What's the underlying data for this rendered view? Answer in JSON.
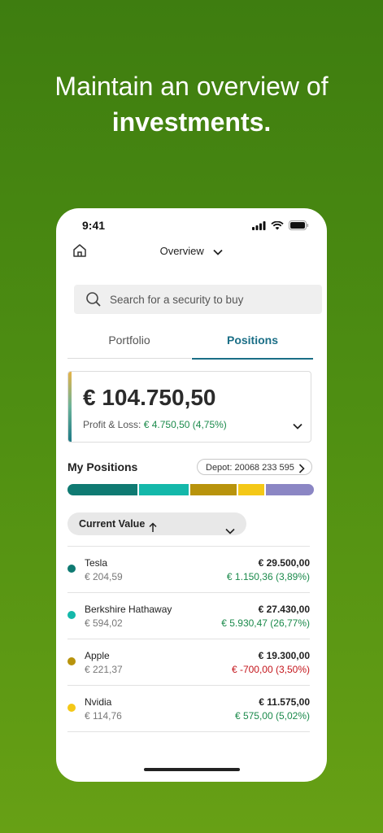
{
  "headline": {
    "line1": "Maintain an overview of",
    "line2": "investments."
  },
  "status_bar": {
    "time": "9:41"
  },
  "nav": {
    "title": "Overview"
  },
  "search": {
    "placeholder": "Search for a security to buy"
  },
  "tabs": [
    {
      "label": "Portfolio",
      "active": false
    },
    {
      "label": "Positions",
      "active": true
    }
  ],
  "summary": {
    "total": "€ 104.750,50",
    "pl_label": "Profit & Loss:",
    "pl_value": "€ 4.750,50 (4,75%)"
  },
  "my_positions": {
    "title": "My Positions",
    "depot_label": "Depot: 20068 233 595"
  },
  "allocation_bar": [
    {
      "color": "#0f7a72",
      "share": 0.29
    },
    {
      "color": "#14b8aa",
      "share": 0.21
    },
    {
      "color": "#b8930c",
      "share": 0.19
    },
    {
      "color": "#f4c817",
      "share": 0.11
    },
    {
      "color": "#8b86c4",
      "share": 0.2
    }
  ],
  "sort": {
    "label": "Current Value"
  },
  "positions": [
    {
      "name": "Tesla",
      "price": "€ 204,59",
      "value": "€ 29.500,00",
      "change": "€ 1.150,36 (3,89%)",
      "direction": "positive",
      "color": "#0f7a72"
    },
    {
      "name": "Berkshire Hathaway",
      "price": "€ 594,02",
      "value": "€ 27.430,00",
      "change": "€ 5.930,47 (26,77%)",
      "direction": "positive",
      "color": "#14b8aa"
    },
    {
      "name": "Apple",
      "price": "€ 221,37",
      "value": "€ 19.300,00",
      "change": "€ -700,00 (3,50%)",
      "direction": "negative",
      "color": "#b8930c"
    },
    {
      "name": "Nvidia",
      "price": "€ 114,76",
      "value": "€ 11.575,00",
      "change": "€ 575,00 (5,02%)",
      "direction": "positive",
      "color": "#f4c817"
    }
  ],
  "colors": {
    "accent": "#1a6e86",
    "positive": "#1b8a4b",
    "negative": "#c4161c"
  }
}
